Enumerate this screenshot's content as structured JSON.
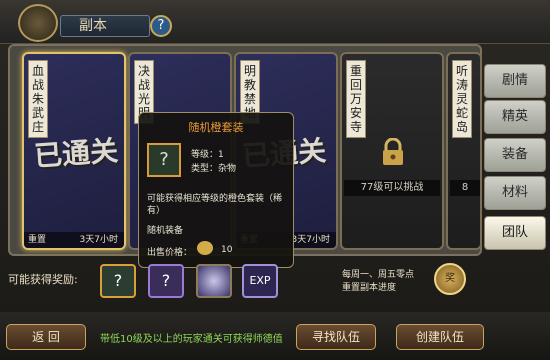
{
  "header": {
    "title": "副本",
    "help": "?"
  },
  "cards": [
    {
      "name": [
        "血",
        "战",
        "朱",
        "武",
        "庄"
      ],
      "stamp": "已通关",
      "footer_left": "重置",
      "footer_right": "3天7小时"
    },
    {
      "name": [
        "决",
        "战",
        "光",
        "明"
      ],
      "stamp": "",
      "footer_left": "",
      "footer_right": ""
    },
    {
      "name": [
        "明",
        "教",
        "禁",
        "地"
      ],
      "stamp": "已通关",
      "footer_left": "重置",
      "footer_right": "3天7小时"
    },
    {
      "name": [
        "重",
        "回",
        "万",
        "安",
        "寺"
      ],
      "requirement": "77级可以挑战",
      "footer_left": "",
      "footer_right": ""
    },
    {
      "name": [
        "听",
        "涛",
        "灵",
        "蛇",
        "岛"
      ],
      "requirement": "8",
      "footer_left": "",
      "footer_right": ""
    }
  ],
  "side_tabs": [
    "剧情",
    "精英",
    "装备",
    "材料",
    "团队"
  ],
  "popup": {
    "title": "随机橙套装",
    "level": "等级：1",
    "type_label": "类型：杂物",
    "desc": "可能获得相应等级的橙色套装（稀有）",
    "sub": "随机装备",
    "price_label": "出售价格：",
    "price_value": "10"
  },
  "rewards": {
    "label": "可能获得奖励:",
    "slots": [
      "?",
      "?",
      "",
      "EXP"
    ]
  },
  "weekly": {
    "line1": "每周一、周五零点",
    "line2": "重置副本进度"
  },
  "buttons": {
    "back": "返  回",
    "find": "寻找队伍",
    "create": "创建队伍"
  },
  "notice": "带低10级及以上的玩家通关可获得师德值"
}
